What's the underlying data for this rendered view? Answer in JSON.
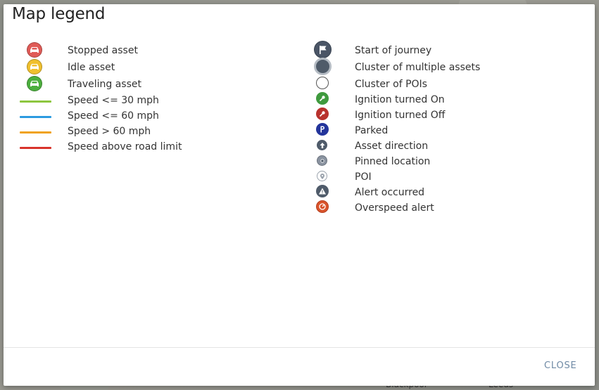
{
  "background_map": {
    "place_labels": [
      "Blackpool",
      "Leeds"
    ]
  },
  "modal": {
    "title": "Map legend",
    "close_label": "CLOSE"
  },
  "legend": {
    "left": [
      {
        "label": "Stopped asset",
        "icon": "car-stopped-icon",
        "color": "#e05b57"
      },
      {
        "label": "Idle asset",
        "icon": "car-idle-icon",
        "color": "#f0c02e"
      },
      {
        "label": "Traveling asset",
        "icon": "car-traveling-icon",
        "color": "#4caf3e"
      },
      {
        "label": "Speed <= 30 mph",
        "icon": "speed-line-green-icon",
        "color": "#8dc63f"
      },
      {
        "label": "Speed <= 60 mph",
        "icon": "speed-line-blue-icon",
        "color": "#2b9be0"
      },
      {
        "label": "Speed > 60 mph",
        "icon": "speed-line-orange-icon",
        "color": "#f0a21a"
      },
      {
        "label": "Speed above road limit",
        "icon": "speed-line-red-icon",
        "color": "#d9342b"
      }
    ],
    "right": [
      {
        "label": "Start of journey",
        "icon": "flag-icon",
        "color": "#4a5566"
      },
      {
        "label": "Cluster of multiple assets",
        "icon": "cluster-assets-icon",
        "color": "#4f5b69"
      },
      {
        "label": "Cluster of POIs",
        "icon": "cluster-pois-icon",
        "color": "#ffffff"
      },
      {
        "label": "Ignition turned On",
        "icon": "ignition-on-icon",
        "color": "#3f9a3e"
      },
      {
        "label": "Ignition turned Off",
        "icon": "ignition-off-icon",
        "color": "#b8322d"
      },
      {
        "label": "Parked",
        "icon": "parked-icon",
        "color": "#23349b"
      },
      {
        "label": "Asset direction",
        "icon": "direction-arrow-icon",
        "color": "#4f5b6a"
      },
      {
        "label": "Pinned location",
        "icon": "pinned-location-icon",
        "color": "#8a93a0"
      },
      {
        "label": "POI",
        "icon": "poi-icon",
        "color": "#9aa2ac"
      },
      {
        "label": "Alert occurred",
        "icon": "alert-icon",
        "color": "#4f5b6a"
      },
      {
        "label": "Overspeed alert",
        "icon": "overspeed-icon",
        "color": "#d9542c"
      }
    ]
  }
}
